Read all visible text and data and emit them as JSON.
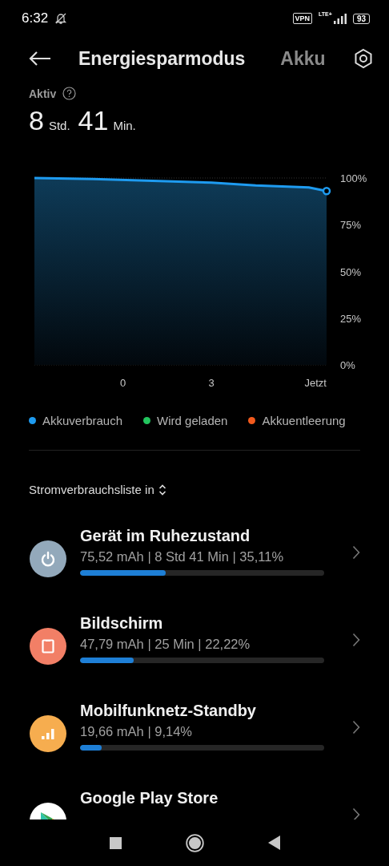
{
  "status_bar": {
    "time": "6:32",
    "vpn": "VPN",
    "network": "LTE+",
    "battery": "93"
  },
  "tabs": [
    {
      "label": "Energiesparmodus",
      "selected": true
    },
    {
      "label": "Akku",
      "selected": false
    }
  ],
  "active": {
    "label": "Aktiv",
    "hours": "8",
    "hours_unit": "Std.",
    "minutes": "41",
    "minutes_unit": "Min."
  },
  "chart_data": {
    "type": "line",
    "x": [
      -3,
      -1,
      1,
      3,
      4.5,
      6.3,
      6.9
    ],
    "series": [
      {
        "name": "Akkuverbrauch",
        "color": "#1e9bf0",
        "values": [
          100,
          99.5,
          98.5,
          97.5,
          96,
          95,
          93
        ]
      },
      {
        "name": "Wird geladen",
        "color": "#22c55e",
        "values": [
          null,
          null,
          null,
          null,
          null,
          null,
          null
        ]
      },
      {
        "name": "Akkuentleerung",
        "color": "#f25a1d",
        "values": [
          null,
          null,
          null,
          null,
          null,
          null,
          null
        ]
      }
    ],
    "xlim": [
      -3,
      6.9
    ],
    "ylim": [
      0,
      100
    ],
    "xticks": [
      {
        "value": 0,
        "label": "0"
      },
      {
        "value": 3,
        "label": "3"
      },
      {
        "value": 6.9,
        "label": "Jetzt"
      }
    ],
    "yticks": [
      {
        "value": 0,
        "label": "0%"
      },
      {
        "value": 25,
        "label": "25%"
      },
      {
        "value": 50,
        "label": "50%"
      },
      {
        "value": 75,
        "label": "75%"
      },
      {
        "value": 100,
        "label": "100%"
      }
    ]
  },
  "list_heading": "Stromverbrauchsliste in",
  "items": [
    {
      "kind": "power",
      "color": "#93a9bb",
      "title": "Gerät im Ruhezustand",
      "detail": "75,52 mAh | 8 Std 41 Min  | 35,11%",
      "level": 0.35
    },
    {
      "kind": "screen",
      "color": "#f27f66",
      "title": "Bildschirm",
      "detail": "47,79 mAh | 25 Min  | 22,22%",
      "level": 0.22
    },
    {
      "kind": "signal",
      "color": "#f6ad4f",
      "title": "Mobilfunknetz-Standby",
      "detail": "19,66 mAh | 9,14%",
      "level": 0.09
    },
    {
      "kind": "app",
      "color": "#ffffff",
      "title": "Google Play Store"
    }
  ]
}
